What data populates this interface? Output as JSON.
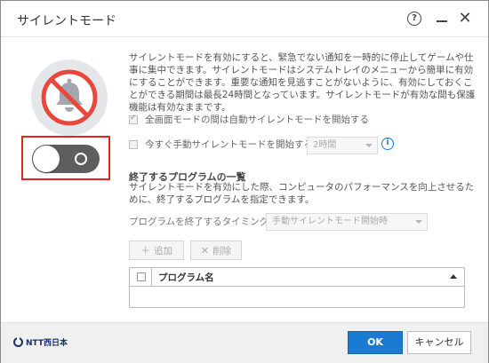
{
  "window": {
    "title": "サイレントモード",
    "help_label": "?",
    "close_label": "✕"
  },
  "icons": {
    "main": "bell-muted-icon",
    "help": "help-icon",
    "minimize": "minimize-icon",
    "close": "close-icon",
    "info": "info-icon"
  },
  "toggle": {
    "state": "off"
  },
  "description": "サイレントモードを有効にすると、緊急でない通知を一時的に停止してゲームや仕事に集中できます。サイレントモードはシステムトレイのメニューから簡単に有効にすることができます。重要な通知を見逃すことがないように、有効にしておくことができる期間は最長24時間となっています。サイレントモードが有効な間も保護機能は有効なままです。",
  "options": {
    "fullscreen_label": "全画面モードの間は自動サイレントモードを開始する",
    "fullscreen_checked": true,
    "manual_label": "今すぐ手動サイレントモードを開始する:",
    "manual_checked": false,
    "duration_value": "2時間",
    "info_label": "i"
  },
  "programs": {
    "section_title": "終了するプログラムの一覧",
    "section_desc": "サイレントモードを有効にした際、コンピュータのパフォーマンスを向上させるために、終了するプログラムを指定できます。",
    "timing_label": "プログラムを終了するタイミング:",
    "timing_value": "手動サイレントモード開始時",
    "add_label": "追加",
    "delete_label": "削除",
    "column_name": "プログラム名"
  },
  "footer": {
    "logo_text": "NTT西日本",
    "ok_label": "OK",
    "cancel_label": "キャンセル"
  },
  "colors": {
    "accent": "#1b7bd3",
    "highlight": "#e0261f",
    "prohibit": "#e8473c",
    "toggle_bg": "#5e5e5e"
  }
}
